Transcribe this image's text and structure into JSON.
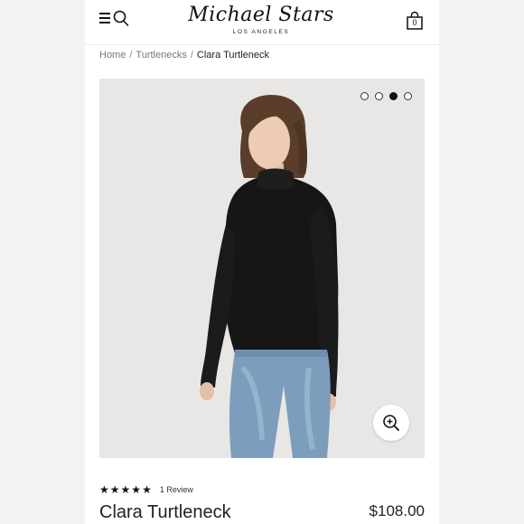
{
  "header": {
    "logo_text": "Michael Stars",
    "logo_sub": "LOS ANGELES",
    "bag_count": "0"
  },
  "breadcrumb": {
    "items": [
      "Home",
      "Turtlenecks"
    ],
    "current": "Clara Turtleneck"
  },
  "gallery": {
    "image_count": 4,
    "active_index": 2
  },
  "product": {
    "rating": 5,
    "review_label": "1 Review",
    "title": "Clara Turtleneck",
    "price": "$108.00"
  },
  "icons": {
    "menu": "menu-icon",
    "search": "search-icon",
    "bag": "shopping-bag-icon",
    "zoom": "zoom-in-icon",
    "star": "star-icon"
  }
}
